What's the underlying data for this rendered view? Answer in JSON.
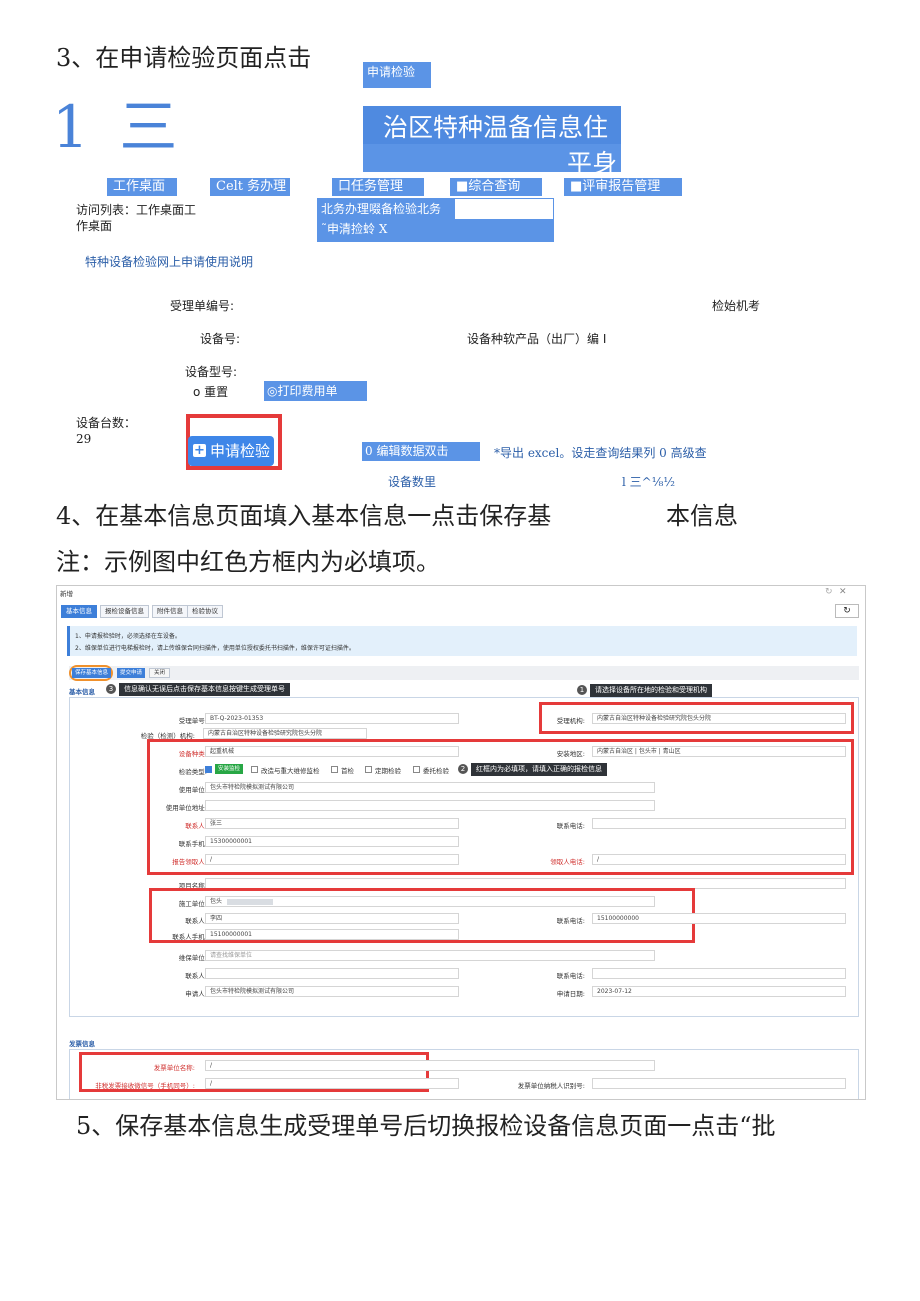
{
  "step3": {
    "text": "3、在申请检验页面点击",
    "button_label": "申请检验",
    "logo_text": "1 三",
    "banner_line1": "治区特种温备信息住",
    "banner_line2": "平身",
    "nav": [
      "工作桌面",
      "Celt 务办理",
      "口任务管理",
      "■综合查询",
      "■评审报告管理"
    ],
    "visit_list_line1": "访问列表：工作桌面工",
    "visit_list_line2": "作桌面",
    "dropdown_line1": "北务办理啜备检验北务",
    "dropdown_line2": "˜申清捡蛉 X",
    "help_link": "特种设备检验网上申请使用说明",
    "receipt_no_label": "受理单编号:",
    "inspect_org_label": "检始机考",
    "device_no_label": "设备号:",
    "product_no_label": "设备种软产品（出厂）编 I",
    "model_label": "设备型号:",
    "reset_label": "o 重置",
    "print_label": "◎打印费用单",
    "count_label": "设备台数：",
    "count_value": "29",
    "apply_button": "申请检验",
    "edit_label": "0 编辑数据双击",
    "export_label": "*导出 excel。设走查询结果列 0 高级查",
    "device_qty_label": "设备数里",
    "page_label": "l 三^⅛½"
  },
  "step4": {
    "line1_a": "4、在基本信息页面填入基本信息一点击保存基",
    "line1_b": "本信息",
    "note": "注：示例图中红色方框内为必填项。"
  },
  "screenshot": {
    "window_title": "新增",
    "tabs": [
      "基本信息",
      "报检设备信息",
      "附件信息",
      "检验协议"
    ],
    "notice_1": "1、申请报检验时，必须选择在车设备。",
    "notice_2": "2、维保单位进行电梯报检时，请上传维保合同扫描件，使用单位授权委托书扫描件，维保许可证扫描件。",
    "save_button": "保存基本信息",
    "submit_button": "提交申请",
    "close_button": "关闭",
    "section_basic": "基本信息",
    "tip3": "信息确认无误后点击保存基本信息按键生成受理单号",
    "tip1": "请选择设备所在地的检验和受理机构",
    "tip2": "红框内为必填项，请填入正确的报检信息",
    "fields": {
      "receipt_no_label": "受理单号:",
      "receipt_no_value": "BT-Q-2023-01353",
      "org_label": "检验（检测）机构:",
      "org_value": "内蒙古自治区特种设备检验研究院包头分院",
      "accept_org_label": "受理机构:",
      "accept_org_value": "内蒙古自治区特种设备检验研究院包头分院",
      "device_type_label": "设备种类:",
      "device_type_value": "起重机械",
      "area_label": "安装地区:",
      "area_value": "内蒙古自治区 | 包头市 | 青山区",
      "inspect_type_label": "检验类型:",
      "inspect_types": [
        "安装监检",
        "改造与重大维修监检",
        "首检",
        "定期检验",
        "委托检验"
      ],
      "use_unit_label": "使用单位:",
      "use_unit_value": "包头市特检院模拟测试有限公司",
      "use_addr_label": "使用单位地址:",
      "contact_label": "联系人:",
      "contact_value": "张三",
      "phone_label": "联系电话:",
      "mobile_label": "联系手机:",
      "mobile_value": "15300000001",
      "report_person_label": "报告领取人:",
      "report_person_value": "/",
      "report_phone_label": "领取人电话:",
      "report_phone_value": "/",
      "project_label": "项目名称:",
      "construct_label": "施工单位:",
      "construct_value": "包头",
      "contact2_label": "联系人:",
      "contact2_value": "李四",
      "phone2_label": "联系电话:",
      "phone2_value": "15100000000",
      "mobile2_label": "联系人手机:",
      "mobile2_value": "15100000001",
      "maint_label": "维保单位:",
      "maint_value": "请查找维保单位",
      "contact3_label": "联系人:",
      "phone3_label": "联系电话:",
      "applicant_label": "申请人:",
      "applicant_value": "包头市特检院模拟测试有限公司",
      "apply_date_label": "申请日期:",
      "apply_date_value": "2023-07-12",
      "invoice_section": "发票信息",
      "invoice_name_label": "发票单位名称:",
      "invoice_name_value": "/",
      "invoice_contact_label": "非税发票接收微信号（手机同号）:",
      "invoice_contact_value": "/",
      "taxpayer_label": "发票单位纳税人识别号:"
    }
  },
  "step5": {
    "text": "5、保存基本信息生成受理单号后切换报检设备信息页面一点击“批"
  },
  "colors": {
    "accent_blue": "#5b94e6",
    "required_red": "#e53a3a",
    "link_blue": "#2b5ea8"
  }
}
